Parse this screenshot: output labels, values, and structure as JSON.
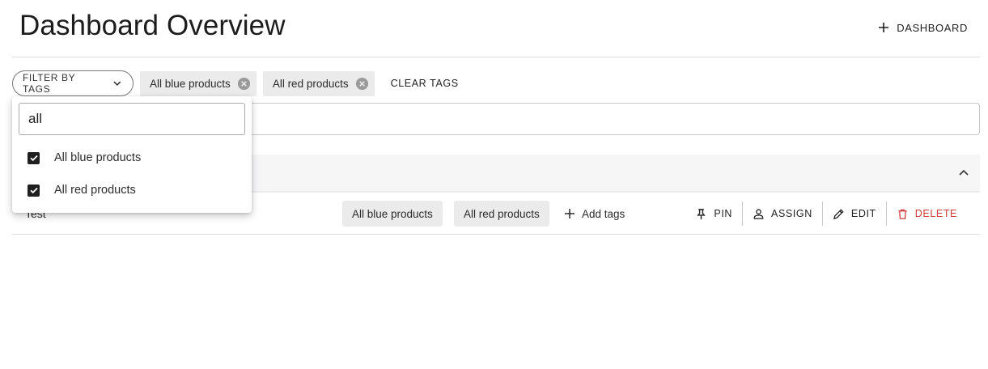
{
  "header": {
    "title": "Dashboard Overview",
    "add_button_label": "DASHBOARD"
  },
  "filter": {
    "button_label": "FILTER BY TAGS",
    "selected_tags": [
      "All blue products",
      "All red products"
    ],
    "clear_label": "CLEAR TAGS"
  },
  "dropdown": {
    "search_value": "all",
    "options": [
      {
        "label": "All blue products",
        "checked": true
      },
      {
        "label": "All red products",
        "checked": true
      }
    ]
  },
  "list": {
    "rows": [
      {
        "name": "Test",
        "tags": [
          "All blue products",
          "All red products"
        ],
        "add_tags_label": "Add tags",
        "actions": {
          "pin": "PIN",
          "assign": "ASSIGN",
          "edit": "EDIT",
          "delete": "DELETE"
        }
      }
    ]
  },
  "colors": {
    "delete": "#d23b3b",
    "chip_bg": "#ebebeb",
    "section_bg": "#f6f6f7"
  },
  "icons": [
    "plus-icon",
    "chevron-down-icon",
    "close-circle-icon",
    "chevron-up-icon",
    "pin-icon",
    "person-icon",
    "pencil-icon",
    "trash-icon",
    "checkbox-checked-icon"
  ]
}
